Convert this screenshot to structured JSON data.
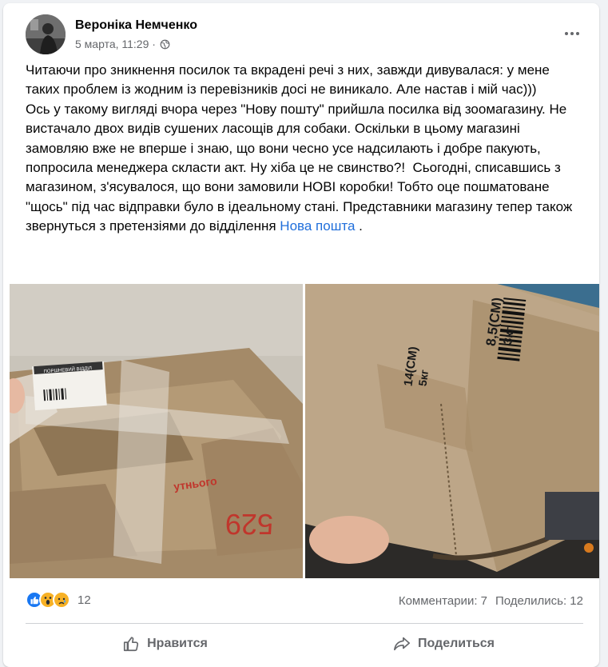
{
  "post": {
    "author": "Вероніка Немченко",
    "date": "5 марта, 11:29 ·",
    "text_main": "Читаючи про зникнення посилок та вкрадені речі з них, завжди дивувалася: у мене таких проблем із жодним із перевізників досі не виникало. Але настав і мій час)))\nОсь у такому вигляді вчора через \"Нову пошту\" прийшла посилка від зоомагазину. Не вистачало двох видів сушених ласощів для собаки. Оскільки в цьому магазині замовляю вже не вперше і знаю, що вони чесно усе надсилають і добре пакують, попросила менеджера скласти акт. Ну хіба це не свинство?!  Сьогодні, списавшись з магазином, з'ясувалося, що вони замовили НОВІ коробки! Тобто оце пошматоване \"щось\" під час відправки було в ідеальному стані. Представники магазину тепер також звернуться з претензіями до відділення ",
    "text_link": "Нова пошта",
    "text_end": " ."
  },
  "photo1": {
    "label_strip": "ПОРШНЕВИЙ ВІДДІЛ",
    "stamp_text": "утнього",
    "handwritten": "529"
  },
  "photo2": {
    "mark1_size": "14(СМ)",
    "mark1_weight": "5кг",
    "mark2_size": "8,5(СМ)",
    "mark2_weight": "3кг"
  },
  "stats": {
    "reaction_count": "12",
    "comments": "Комментарии: 7",
    "shares": "Поделились: 12"
  },
  "actions": {
    "like": "Нравится",
    "share": "Поделиться"
  },
  "colors": {
    "link": "#216fdb",
    "secondary_text": "#65676b",
    "like_blue": "#1877f2",
    "wow_yellow": "#f7b125"
  }
}
